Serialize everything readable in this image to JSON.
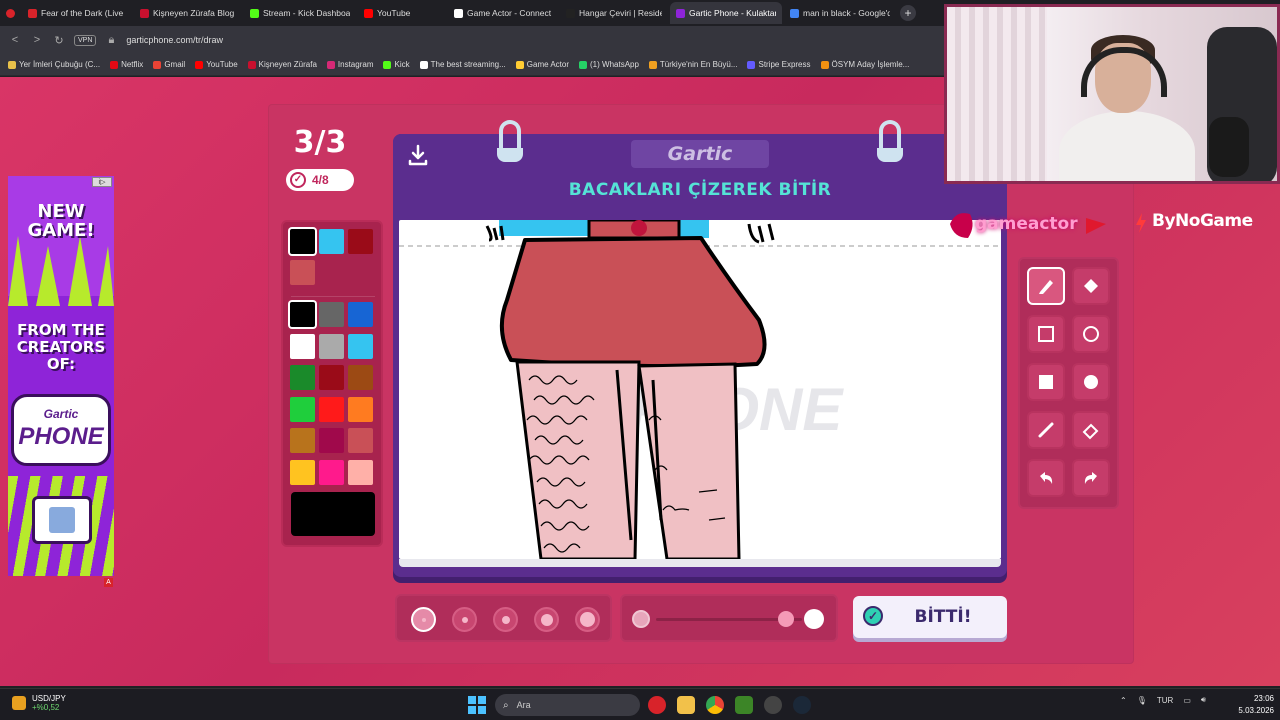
{
  "browser": {
    "tabs": [
      {
        "label": "Fear of the Dark (Live",
        "fav": "#d8232a",
        "active": false
      },
      {
        "label": "Kişneyen Zürafa Blog",
        "fav": "#c8102e",
        "active": false
      },
      {
        "label": "Stream - Kick Dashboard",
        "fav": "#53fc18",
        "active": false
      },
      {
        "label": "YouTube",
        "fav": "#ff0000",
        "active": false
      },
      {
        "label": "Game Actor - Connect wit",
        "fav": "#ffffff",
        "active": false
      },
      {
        "label": "Hangar Çeviri | Resident E",
        "fav": "#222222",
        "active": false
      },
      {
        "label": "Gartic Phone - Kulaktan K",
        "fav": "#8e24d8",
        "active": true
      },
      {
        "label": "man in black - Google'da",
        "fav": "#4285f4",
        "active": false
      }
    ],
    "url": "garticphone.com/tr/draw",
    "vpn_label": "VPN",
    "bookmarks": [
      {
        "label": "Yer İmleri Çubuğu (C...",
        "fav": "#e8c14a"
      },
      {
        "label": "Netflix",
        "fav": "#e50914"
      },
      {
        "label": "Gmail",
        "fav": "#ea4335"
      },
      {
        "label": "YouTube",
        "fav": "#ff0000"
      },
      {
        "label": "Kişneyen Zürafa",
        "fav": "#c8102e"
      },
      {
        "label": "Instagram",
        "fav": "#d62976"
      },
      {
        "label": "Kick",
        "fav": "#53fc18"
      },
      {
        "label": "The best streaming...",
        "fav": "#ffffff"
      },
      {
        "label": "Game Actor",
        "fav": "#ffcc33"
      },
      {
        "label": "(1) WhatsApp",
        "fav": "#25d366"
      },
      {
        "label": "Türkiye'nin En Büyü...",
        "fav": "#f0a020"
      },
      {
        "label": "Stripe Express",
        "fav": "#635bff"
      },
      {
        "label": "ÖSYM Aday İşlemle...",
        "fav": "#f29111"
      }
    ]
  },
  "ad": {
    "headline": "NEW GAME!",
    "subline": "FROM THE CREATORS OF:",
    "logo_top": "Gartic",
    "logo_bottom": "PHONE",
    "info_label": "i▷",
    "marker": "A"
  },
  "game": {
    "round": "3/3",
    "progress": "4/8",
    "brand": "Gartic",
    "prompt": "BACAKLARI ÇİZEREK BİTİR",
    "done_label": "BİTTİ!",
    "selected_color": "#000000",
    "palette_top": [
      "#000000",
      "#35c4f0",
      "#9a0b18",
      "#c95057"
    ],
    "palette": [
      "#000000",
      "#666666",
      "#1765d4",
      "#ffffff",
      "#aaaaaa",
      "#35c4f0",
      "#1a8a2a",
      "#9a0b18",
      "#9c4a14",
      "#1fce3c",
      "#ff1a1a",
      "#ff7b20",
      "#b8731c",
      "#a0094b",
      "#c95057",
      "#ffc320",
      "#ff1a8c",
      "#ffb0a8"
    ],
    "tools": [
      "pen-icon",
      "bucket-icon",
      "rect-outline-icon",
      "ellipse-outline-icon",
      "rect-fill-icon",
      "ellipse-fill-icon",
      "line-icon",
      "eraser-icon",
      "undo-icon",
      "redo-icon"
    ],
    "brush_sizes_selected_index": 0,
    "opacity_level": 1.0
  },
  "overlay": {
    "brand_text": "gameactor",
    "sponsor": "ByNoGame"
  },
  "taskbar": {
    "stock_name": "USD/JPY",
    "stock_change": "+%0,52",
    "search_placeholder": "Ara",
    "language": "TUR",
    "time": "23:06",
    "date": "5.03.2026"
  }
}
